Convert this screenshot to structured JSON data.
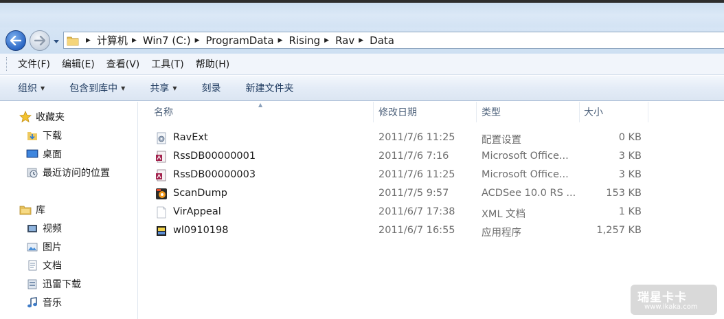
{
  "address": {
    "crumbs": [
      "计算机",
      "Win7 (C:)",
      "ProgramData",
      "Rising",
      "Rav",
      "Data"
    ]
  },
  "menu": [
    "文件(F)",
    "编辑(E)",
    "查看(V)",
    "工具(T)",
    "帮助(H)"
  ],
  "commands": {
    "organize": "组织",
    "include_in_library": "包含到库中",
    "share": "共享",
    "burn": "刻录",
    "new_folder": "新建文件夹"
  },
  "nav": {
    "favorites": "收藏夹",
    "downloads": "下载",
    "desktop": "桌面",
    "recent": "最近访问的位置",
    "libraries": "库",
    "videos": "视频",
    "pictures": "图片",
    "documents": "文档",
    "xunlei": "迅雷下载",
    "music": "音乐"
  },
  "columns": {
    "name": "名称",
    "date": "修改日期",
    "type": "类型",
    "size": "大小"
  },
  "files": [
    {
      "name": "RavExt",
      "date": "2011/7/6 11:25",
      "type": "配置设置",
      "size": "0 KB",
      "icon": "config-icon"
    },
    {
      "name": "RssDB00000001",
      "date": "2011/7/6 7:16",
      "type": "Microsoft Office...",
      "size": "3 KB",
      "icon": "access-db-icon"
    },
    {
      "name": "RssDB00000003",
      "date": "2011/7/6 11:25",
      "type": "Microsoft Office...",
      "size": "3 KB",
      "icon": "access-db-icon"
    },
    {
      "name": "ScanDump",
      "date": "2011/7/5 9:57",
      "type": "ACDSee 10.0 RS ...",
      "size": "153 KB",
      "icon": "acdsee-icon"
    },
    {
      "name": "VirAppeal",
      "date": "2011/6/7 17:38",
      "type": "XML 文档",
      "size": "1 KB",
      "icon": "blank-file-icon"
    },
    {
      "name": "wl0910198",
      "date": "2011/6/7 16:55",
      "type": "应用程序",
      "size": "1,257 KB",
      "icon": "application-icon"
    }
  ],
  "watermark": {
    "logo": "瑞星卡卡",
    "url": "www.ikaka.com"
  },
  "colors": {
    "chrome_blue": "#cddff2",
    "command_text": "#1e3a5f",
    "secondary_text": "#6d6d6d",
    "header_text": "#4c607a"
  }
}
